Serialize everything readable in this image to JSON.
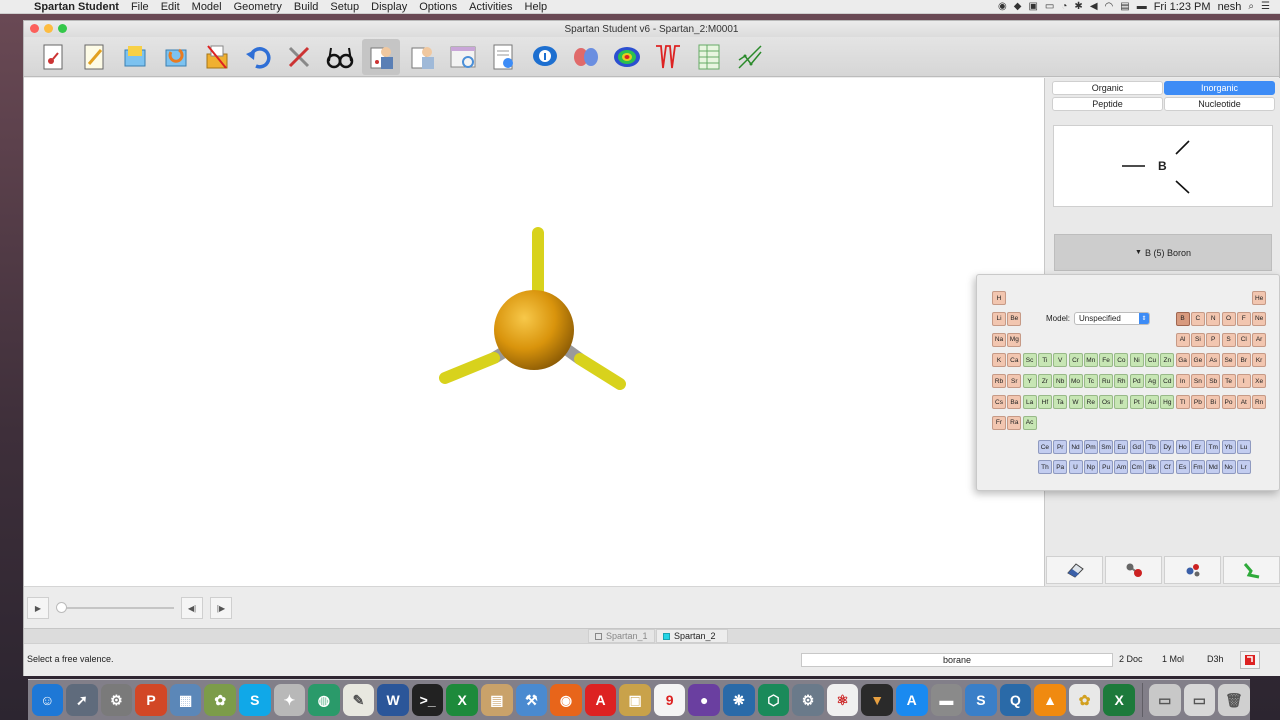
{
  "menubar": {
    "app_name": "Spartan Student",
    "items": [
      "File",
      "Edit",
      "Model",
      "Geometry",
      "Build",
      "Setup",
      "Display",
      "Options",
      "Activities",
      "Help"
    ],
    "clock": "Fri 1:23 PM",
    "user": "nesh"
  },
  "window": {
    "title": "Spartan Student v6 - Spartan_2:M0001"
  },
  "toolbar": {
    "icons": [
      "new-molecule-icon",
      "edit-icon",
      "open-file-icon",
      "recent-file-icon",
      "save-icon",
      "undo-icon",
      "build-tool-icon",
      "view-glasses-icon",
      "builder-icon",
      "calculations-icon",
      "monitor-icon",
      "output-icon",
      "info-icon",
      "orbitals-icon",
      "surfaces-icon",
      "spectra-icon",
      "spreadsheet-icon",
      "plot-icon"
    ]
  },
  "builder": {
    "tabs": {
      "organic": "Organic",
      "inorganic": "Inorganic",
      "peptide": "Peptide",
      "nucleotide": "Nucleotide"
    },
    "selected_tab": "Inorganic",
    "preview_atom": "B",
    "element_label": "B (5) Boron"
  },
  "periodic_table": {
    "model_label": "Model:",
    "model_value": "Unspecified",
    "selected_element": "B",
    "row1_left": [
      "H"
    ],
    "row1_right": [
      "He"
    ],
    "row2_left": [
      "Li",
      "Be"
    ],
    "row2_right": [
      "B",
      "C",
      "N",
      "O",
      "F",
      "Ne"
    ],
    "row3_left": [
      "Na",
      "Mg"
    ],
    "row3_right": [
      "Al",
      "Si",
      "P",
      "S",
      "Cl",
      "Ar"
    ],
    "row4": [
      "K",
      "Ca",
      "Sc",
      "Ti",
      "V",
      "Cr",
      "Mn",
      "Fe",
      "Co",
      "Ni",
      "Cu",
      "Zn",
      "Ga",
      "Ge",
      "As",
      "Se",
      "Br",
      "Kr"
    ],
    "row5": [
      "Rb",
      "Sr",
      "Y",
      "Zr",
      "Nb",
      "Mo",
      "Tc",
      "Ru",
      "Rh",
      "Pd",
      "Ag",
      "Cd",
      "In",
      "Sn",
      "Sb",
      "Te",
      "I",
      "Xe"
    ],
    "row6": [
      "Cs",
      "Ba",
      "La",
      "Hf",
      "Ta",
      "W",
      "Re",
      "Os",
      "Ir",
      "Pt",
      "Au",
      "Hg",
      "Tl",
      "Pb",
      "Bi",
      "Po",
      "At",
      "Rn"
    ],
    "row7": [
      "Fr",
      "Ra",
      "Ac"
    ],
    "lanthanides": [
      "Ce",
      "Pr",
      "Nd",
      "Pm",
      "Sm",
      "Eu",
      "Gd",
      "Tb",
      "Dy",
      "Ho",
      "Er",
      "Tm",
      "Yb",
      "Lu"
    ],
    "actinides": [
      "Th",
      "Pa",
      "U",
      "Np",
      "Pu",
      "Am",
      "Cm",
      "Bk",
      "Cf",
      "Es",
      "Fm",
      "Md",
      "No",
      "Lr"
    ]
  },
  "bottom_tools": [
    "eraser-icon",
    "bond-tool-icon",
    "minimize-icon",
    "ring-tool-icon"
  ],
  "doc_tabs": [
    "Spartan_1",
    "Spartan_2"
  ],
  "active_doc_tab": "Spartan_2",
  "status": {
    "message": "Select a free valence.",
    "molecule_name": "borane",
    "doc_count": "2 Doc",
    "mol_count": "1 Mol",
    "symmetry": "D3h"
  },
  "colors": {
    "accent": "#3d8cf6",
    "boron_atom": "#d9940c",
    "free_valence": "#e8e020"
  }
}
